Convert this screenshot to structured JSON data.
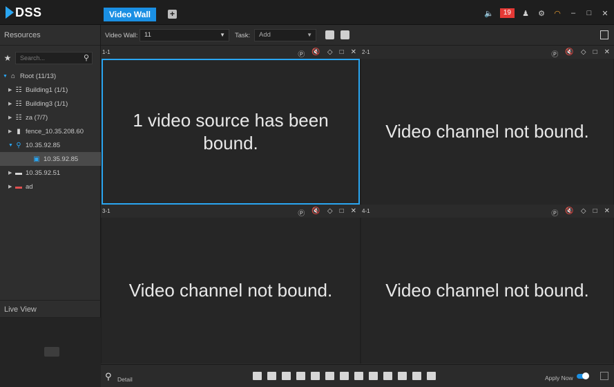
{
  "app": {
    "logo": "DSS"
  },
  "topbar": {
    "active_tab": "Video Wall",
    "add_tab_symbol": "+",
    "alarm_count": "19",
    "icons": [
      "speaker-icon",
      "user-icon",
      "gear-icon",
      "signal-icon",
      "minimize-icon",
      "maximize-icon",
      "close-icon"
    ]
  },
  "sidebar": {
    "title": "Resources",
    "search_placeholder": "Search...",
    "tree": [
      {
        "label": "Root (11/13)",
        "icon": "org-root-icon",
        "expanded": true
      },
      {
        "label": "Building1 (1/1)",
        "icon": "org-node-icon"
      },
      {
        "label": "Building3 (1/1)",
        "icon": "org-node-icon"
      },
      {
        "label": "za (7/7)",
        "icon": "org-node-icon"
      },
      {
        "label": "fence_10.35.208.60",
        "icon": "device-icon"
      },
      {
        "label": "10.35.92.85",
        "icon": "camera-device-icon",
        "expanded": true
      },
      {
        "label": "10.35.92.85",
        "icon": "channel-icon",
        "selected": true
      },
      {
        "label": "10.35.92.51",
        "icon": "nvr-icon"
      },
      {
        "label": "ad",
        "icon": "decoder-icon"
      }
    ],
    "live_view_title": "Live View"
  },
  "config": {
    "video_wall_label": "Video Wall:",
    "video_wall_value": "11",
    "task_label": "Task:",
    "task_value": "Add"
  },
  "panes": [
    {
      "id": "1-1",
      "message": "1 video source has been bound.",
      "active": true
    },
    {
      "id": "2-1",
      "message": "Video channel not bound."
    },
    {
      "id": "3-1",
      "message": "Video channel not bound."
    },
    {
      "id": "4-1",
      "message": "Video channel not bound."
    }
  ],
  "bottombar": {
    "detail_label": "Detail",
    "apply_label": "Apply Now",
    "layout_tools": [
      "1x1",
      "2x2",
      "3x3",
      "4x4",
      "36",
      "64",
      "custom",
      "tree",
      "rotate",
      "lock",
      "split",
      "swap",
      "screen"
    ]
  },
  "colors": {
    "accent": "#1a8fe3",
    "alarm": "#e53935",
    "background": "#2b2b2b"
  }
}
